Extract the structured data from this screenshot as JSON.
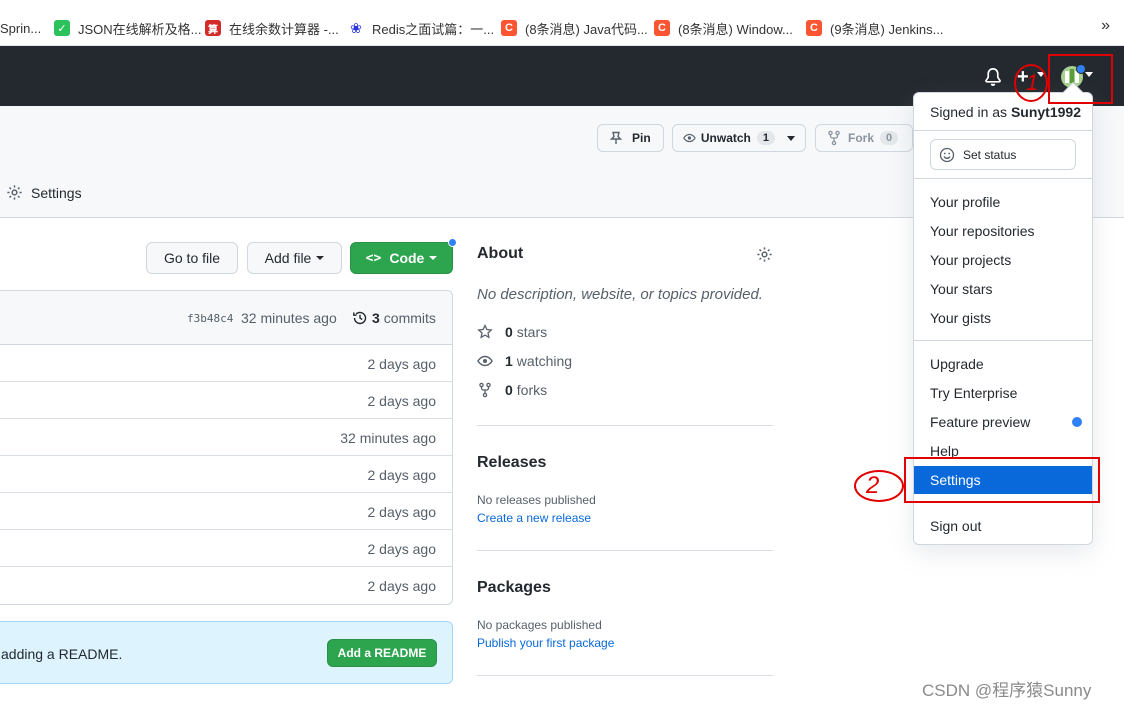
{
  "bookmarks": [
    {
      "label": "Sprin...",
      "fav": "",
      "color": "#ffffff"
    },
    {
      "label": "JSON在线解析及格...",
      "fav": "✓",
      "color": "#2bc25b"
    },
    {
      "label": "在线余数计算器 -...",
      "fav": "算",
      "color": "#d42a2a"
    },
    {
      "label": "Redis之面试篇：一...",
      "fav": "❀",
      "color": "#2932e1"
    },
    {
      "label": "(8条消息) Java代码...",
      "fav": "C",
      "color": "#fc5531"
    },
    {
      "label": "(8条消息) Window...",
      "fav": "C",
      "color": "#fc5531"
    },
    {
      "label": "(9条消息) Jenkins...",
      "fav": "C",
      "color": "#fc5531"
    }
  ],
  "bookmarks_more": "»",
  "repo_actions": {
    "pin": "Pin",
    "unwatch": "Unwatch",
    "unwatch_count": "1",
    "fork": "Fork",
    "fork_count": "0"
  },
  "tabs": {
    "settings": "Settings"
  },
  "file_buttons": {
    "go_to_file": "Go to file",
    "add_file": "Add file",
    "code": "Code"
  },
  "commit_bar": {
    "sha": "f3b48c4",
    "time": "32 minutes ago",
    "commits_count": "3",
    "commits_label": "commits"
  },
  "file_rows": [
    "2 days ago",
    "2 days ago",
    "32 minutes ago",
    "2 days ago",
    "2 days ago",
    "2 days ago",
    "2 days ago"
  ],
  "readme_banner": {
    "text": "adding a README.",
    "button": "Add a README"
  },
  "about": {
    "title": "About",
    "description": "No description, website, or topics provided.",
    "stars_count": "0",
    "stars_label": "stars",
    "watching_count": "1",
    "watching_label": "watching",
    "forks_count": "0",
    "forks_label": "forks"
  },
  "releases": {
    "title": "Releases",
    "empty": "No releases published",
    "link": "Create a new release"
  },
  "packages": {
    "title": "Packages",
    "empty": "No packages published",
    "link": "Publish your first package"
  },
  "user_menu": {
    "signed_in_prefix": "Signed in as",
    "username": "Sunyt1992",
    "set_status": "Set status",
    "items_profile": [
      "Your profile",
      "Your repositories",
      "Your projects",
      "Your stars",
      "Your gists"
    ],
    "items_more": [
      "Upgrade",
      "Try Enterprise",
      "Feature preview",
      "Help"
    ],
    "settings": "Settings",
    "sign_out": "Sign out"
  },
  "annotations": {
    "mark_1": "1",
    "mark_2": "2"
  },
  "watermark": "CSDN @程序猿Sunny",
  "colors": {
    "header_bg": "#24292f",
    "primary_green": "#2da44e",
    "accent_blue": "#0969da",
    "annotation_red": "#e00000"
  }
}
